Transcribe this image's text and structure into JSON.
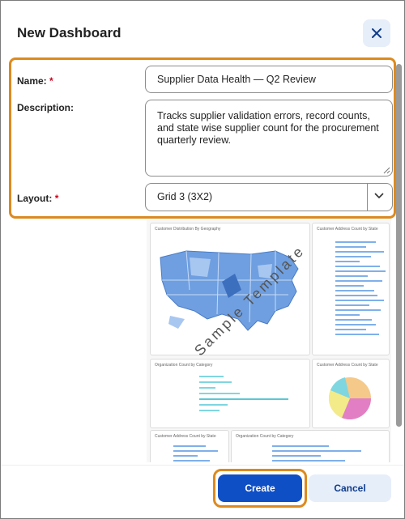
{
  "dialog": {
    "title": "New Dashboard",
    "close_icon": "close-icon"
  },
  "form": {
    "name_label": "Name:",
    "description_label": "Description:",
    "layout_label": "Layout:",
    "required_mark": "*",
    "name_value": "Supplier Data Health — Q2 Review",
    "description_value": "Tracks supplier validation errors, record counts, and state wise supplier count for the procurement quarterly review.",
    "layout_value": "Grid 3 (3X2)"
  },
  "preview": {
    "watermark": "Sample Template",
    "cards": [
      {
        "title": "Customer Distribution By Geography"
      },
      {
        "title": "Customer Address Count by State"
      },
      {
        "title": "Organization Count by Category"
      },
      {
        "title": "Customer Address Count by State"
      },
      {
        "title": "Customer Address Count by State"
      },
      {
        "title": "Organization Count by Category"
      }
    ]
  },
  "footer": {
    "create_label": "Create",
    "cancel_label": "Cancel"
  },
  "colors": {
    "accent": "#0f4fc6",
    "highlight": "#dc8a1f",
    "required": "#d0021b"
  }
}
